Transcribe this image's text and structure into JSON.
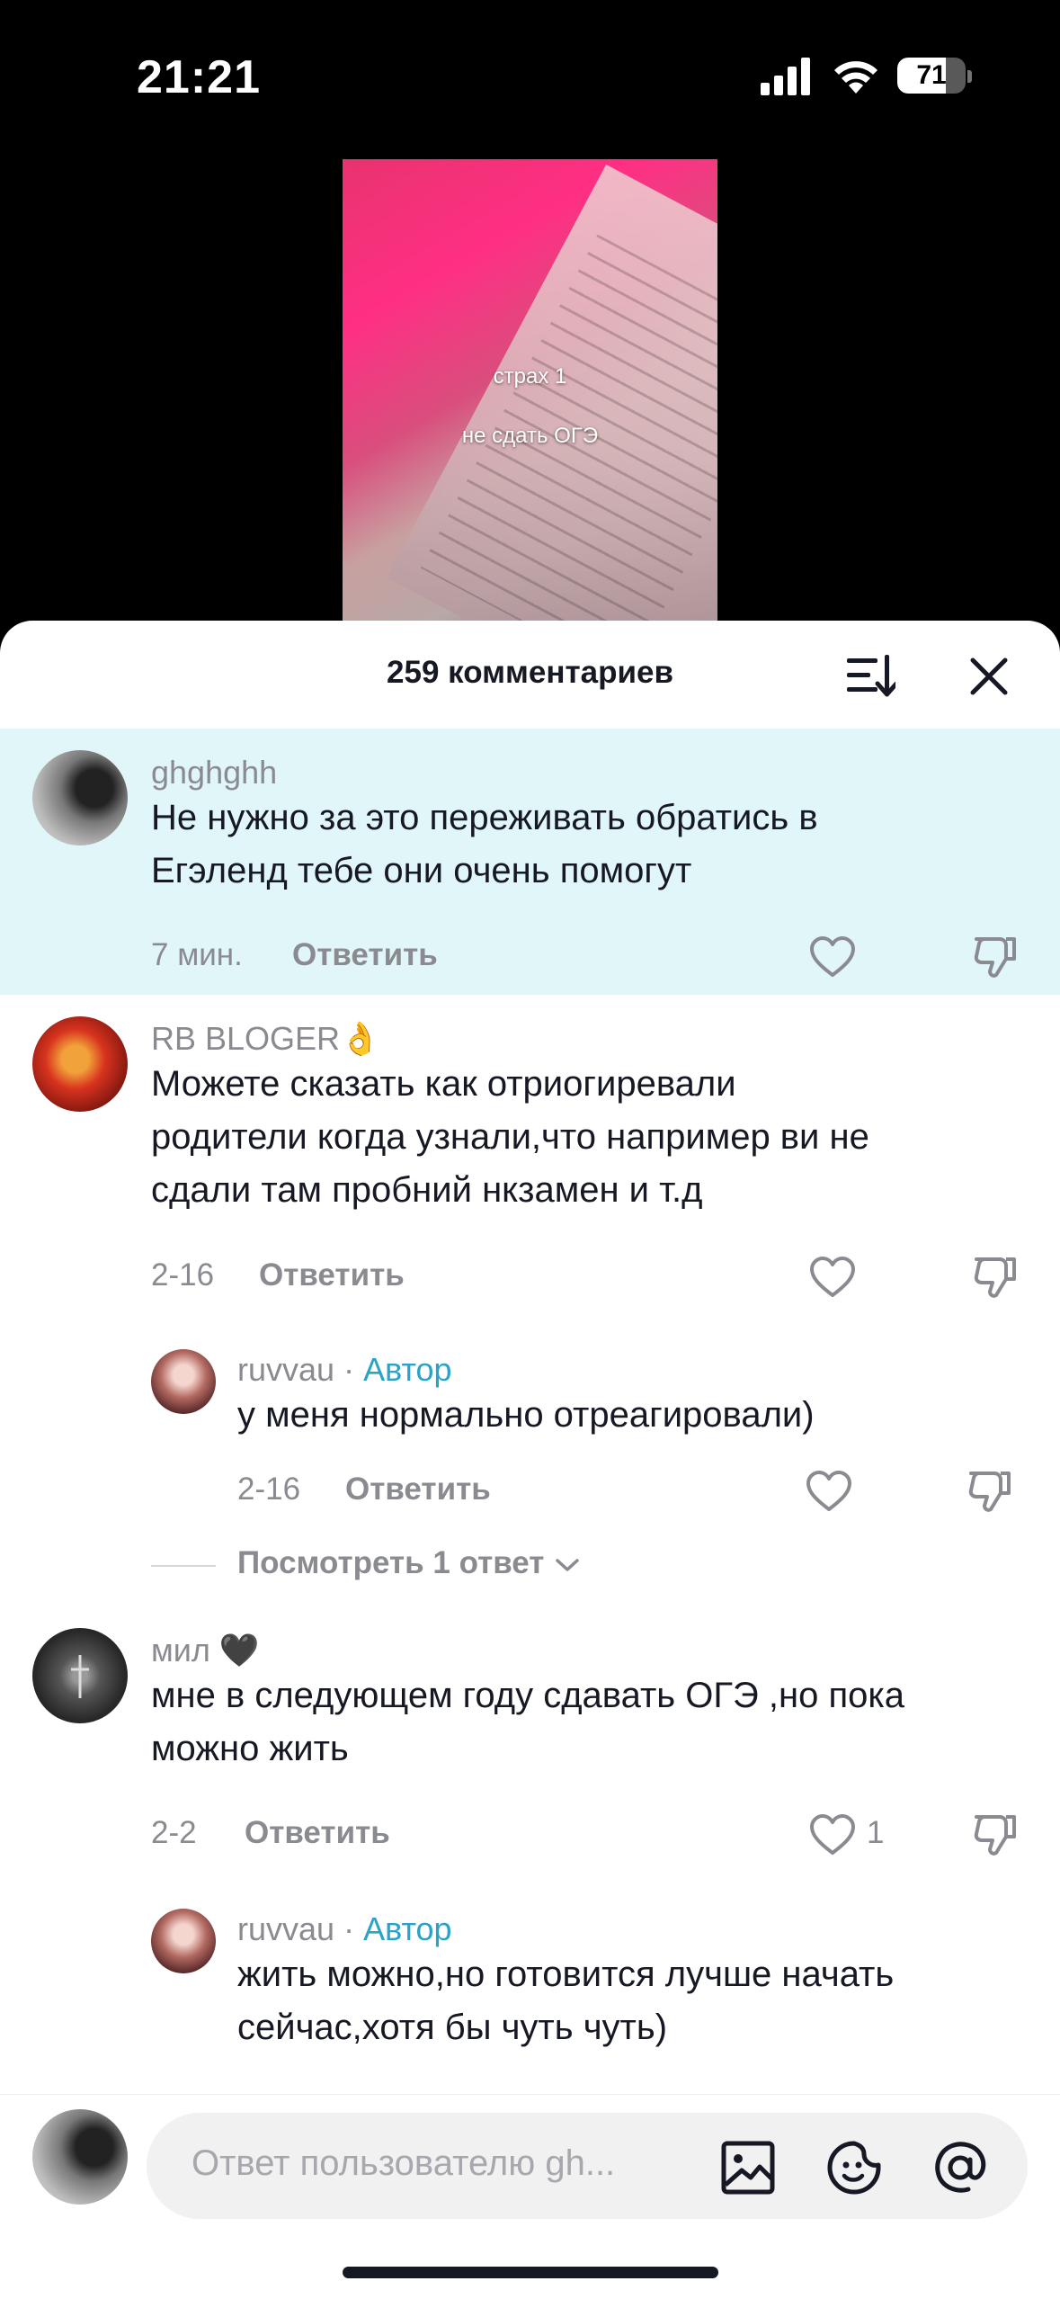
{
  "status_bar": {
    "time": "21:21",
    "battery": "71",
    "battery_level": 0.71
  },
  "video": {
    "caption_line1": "страх 1",
    "caption_line2": "не сдать ОГЭ"
  },
  "header": {
    "title": "259 комментариев",
    "sort_icon": "sort-icon",
    "close_icon": "close-icon"
  },
  "comments": [
    {
      "username": "ghghghh",
      "text_line1": "Не нужно за это переживать обратись в",
      "text_line2": "Егэленд тебе они очень помогут",
      "time": "7 мин.",
      "reply": "Ответить",
      "likes": ""
    },
    {
      "username": "RB BLOGER👌",
      "text_line1": "Можете сказать как отриогиревали",
      "text_line2": "родители когда узнали,что например ви не",
      "text_line3": "сдали там пробний нкзамен и т.д",
      "time": "2-16",
      "reply": "Ответить",
      "likes": "",
      "replies": [
        {
          "username": "ruvvau",
          "separator": "·",
          "author_tag": "Автор",
          "text_line1": "у меня нормально отреагировали)",
          "time": "2-16",
          "reply": "Ответить"
        }
      ],
      "view_more": "Посмотреть 1 ответ"
    },
    {
      "username": "мил 🖤",
      "text_line1": "мне в следующем году сдавать ОГЭ ,но пока",
      "text_line2": "можно жить",
      "time": "2-2",
      "reply": "Ответить",
      "likes": "1",
      "replies": [
        {
          "username": "ruvvau",
          "separator": "·",
          "author_tag": "Автор",
          "text_line1": "жить можно,но готовится лучше начать",
          "text_line2": "сейчас,хотя бы чуть чуть)"
        }
      ]
    }
  ],
  "composer": {
    "placeholder": "Ответ пользователю gh...",
    "icons": [
      "image-icon",
      "sticker-icon",
      "mention-icon"
    ]
  },
  "colors": {
    "highlight": "#e1f6f9",
    "author": "#2aa3c8",
    "muted": "#8a8b91",
    "text": "#161823"
  }
}
